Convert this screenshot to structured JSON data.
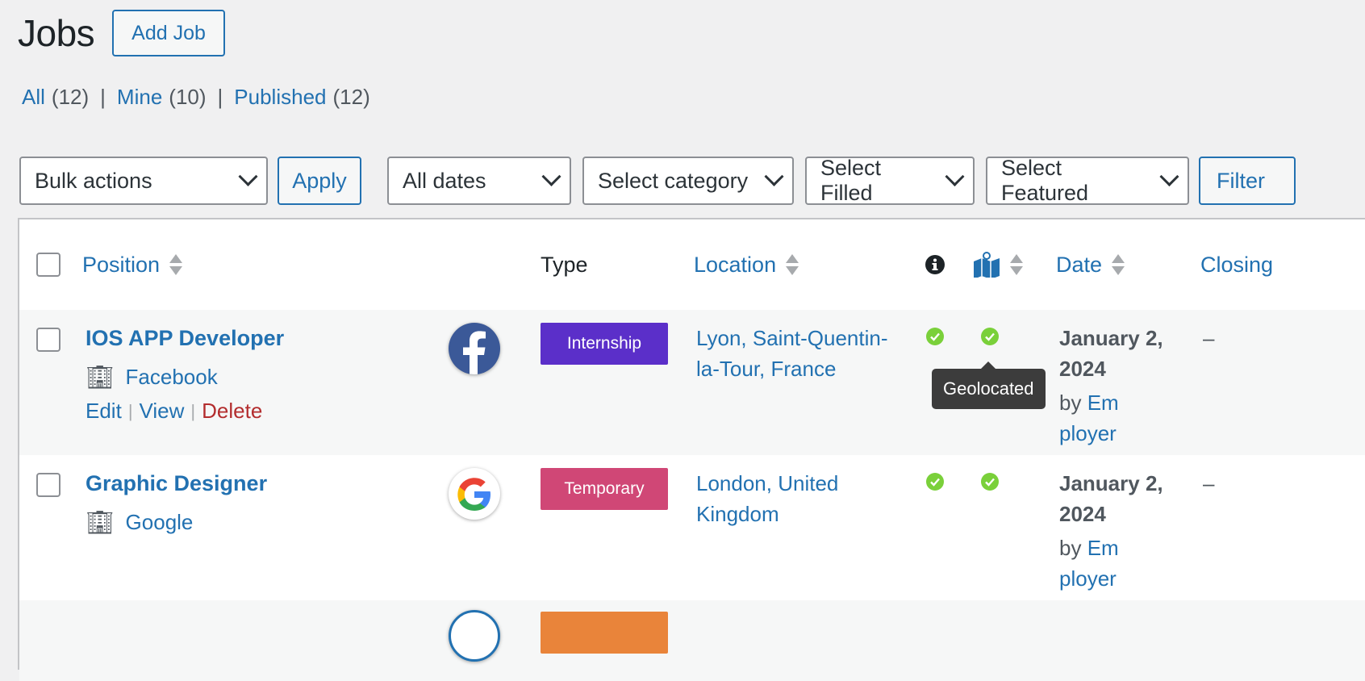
{
  "page": {
    "title": "Jobs",
    "add_button": "Add Job"
  },
  "views": [
    {
      "label": "All",
      "count": "(12)"
    },
    {
      "label": "Mine",
      "count": "(10)"
    },
    {
      "label": "Published",
      "count": "(12)"
    }
  ],
  "views_separator": "|",
  "toolbar": {
    "bulk_actions": "Bulk actions",
    "apply": "Apply",
    "dates": "All dates",
    "category": "Select category",
    "filled": "Select Filled",
    "featured": "Select Featured",
    "filter": "Filter"
  },
  "columns": {
    "position": "Position",
    "type": "Type",
    "location": "Location",
    "date": "Date",
    "closing": "Closing"
  },
  "tooltip": "Geolocated",
  "rows": [
    {
      "title": "IOS APP Developer",
      "company": "Facebook",
      "actions": {
        "edit": "Edit",
        "view": "View",
        "delete": "Delete"
      },
      "type": "Internship",
      "type_color": "#5b2fc9",
      "location_line1": "Lyon, Saint-Quentin-",
      "location_line2": "la-Tour, France",
      "date_line1": "January 2,",
      "date_line2": "2024",
      "by": "by",
      "author_line1": "Em",
      "author_line2": "ployer",
      "closing": "–",
      "logo": "facebook-logo"
    },
    {
      "title": "Graphic Designer",
      "company": "Google",
      "type": "Temporary",
      "type_color": "#d04776",
      "location_line1": "London, United",
      "location_line2": "Kingdom",
      "date_line1": "January 2,",
      "date_line2": "2024",
      "by": "by",
      "author_line1": "Em",
      "author_line2": "ployer",
      "closing": "–",
      "logo": "google-logo"
    }
  ],
  "colors": {
    "link": "#2271b1",
    "check": "#7ad03a",
    "delete": "#b32d2e",
    "next_row_badge": "#e9843a"
  }
}
